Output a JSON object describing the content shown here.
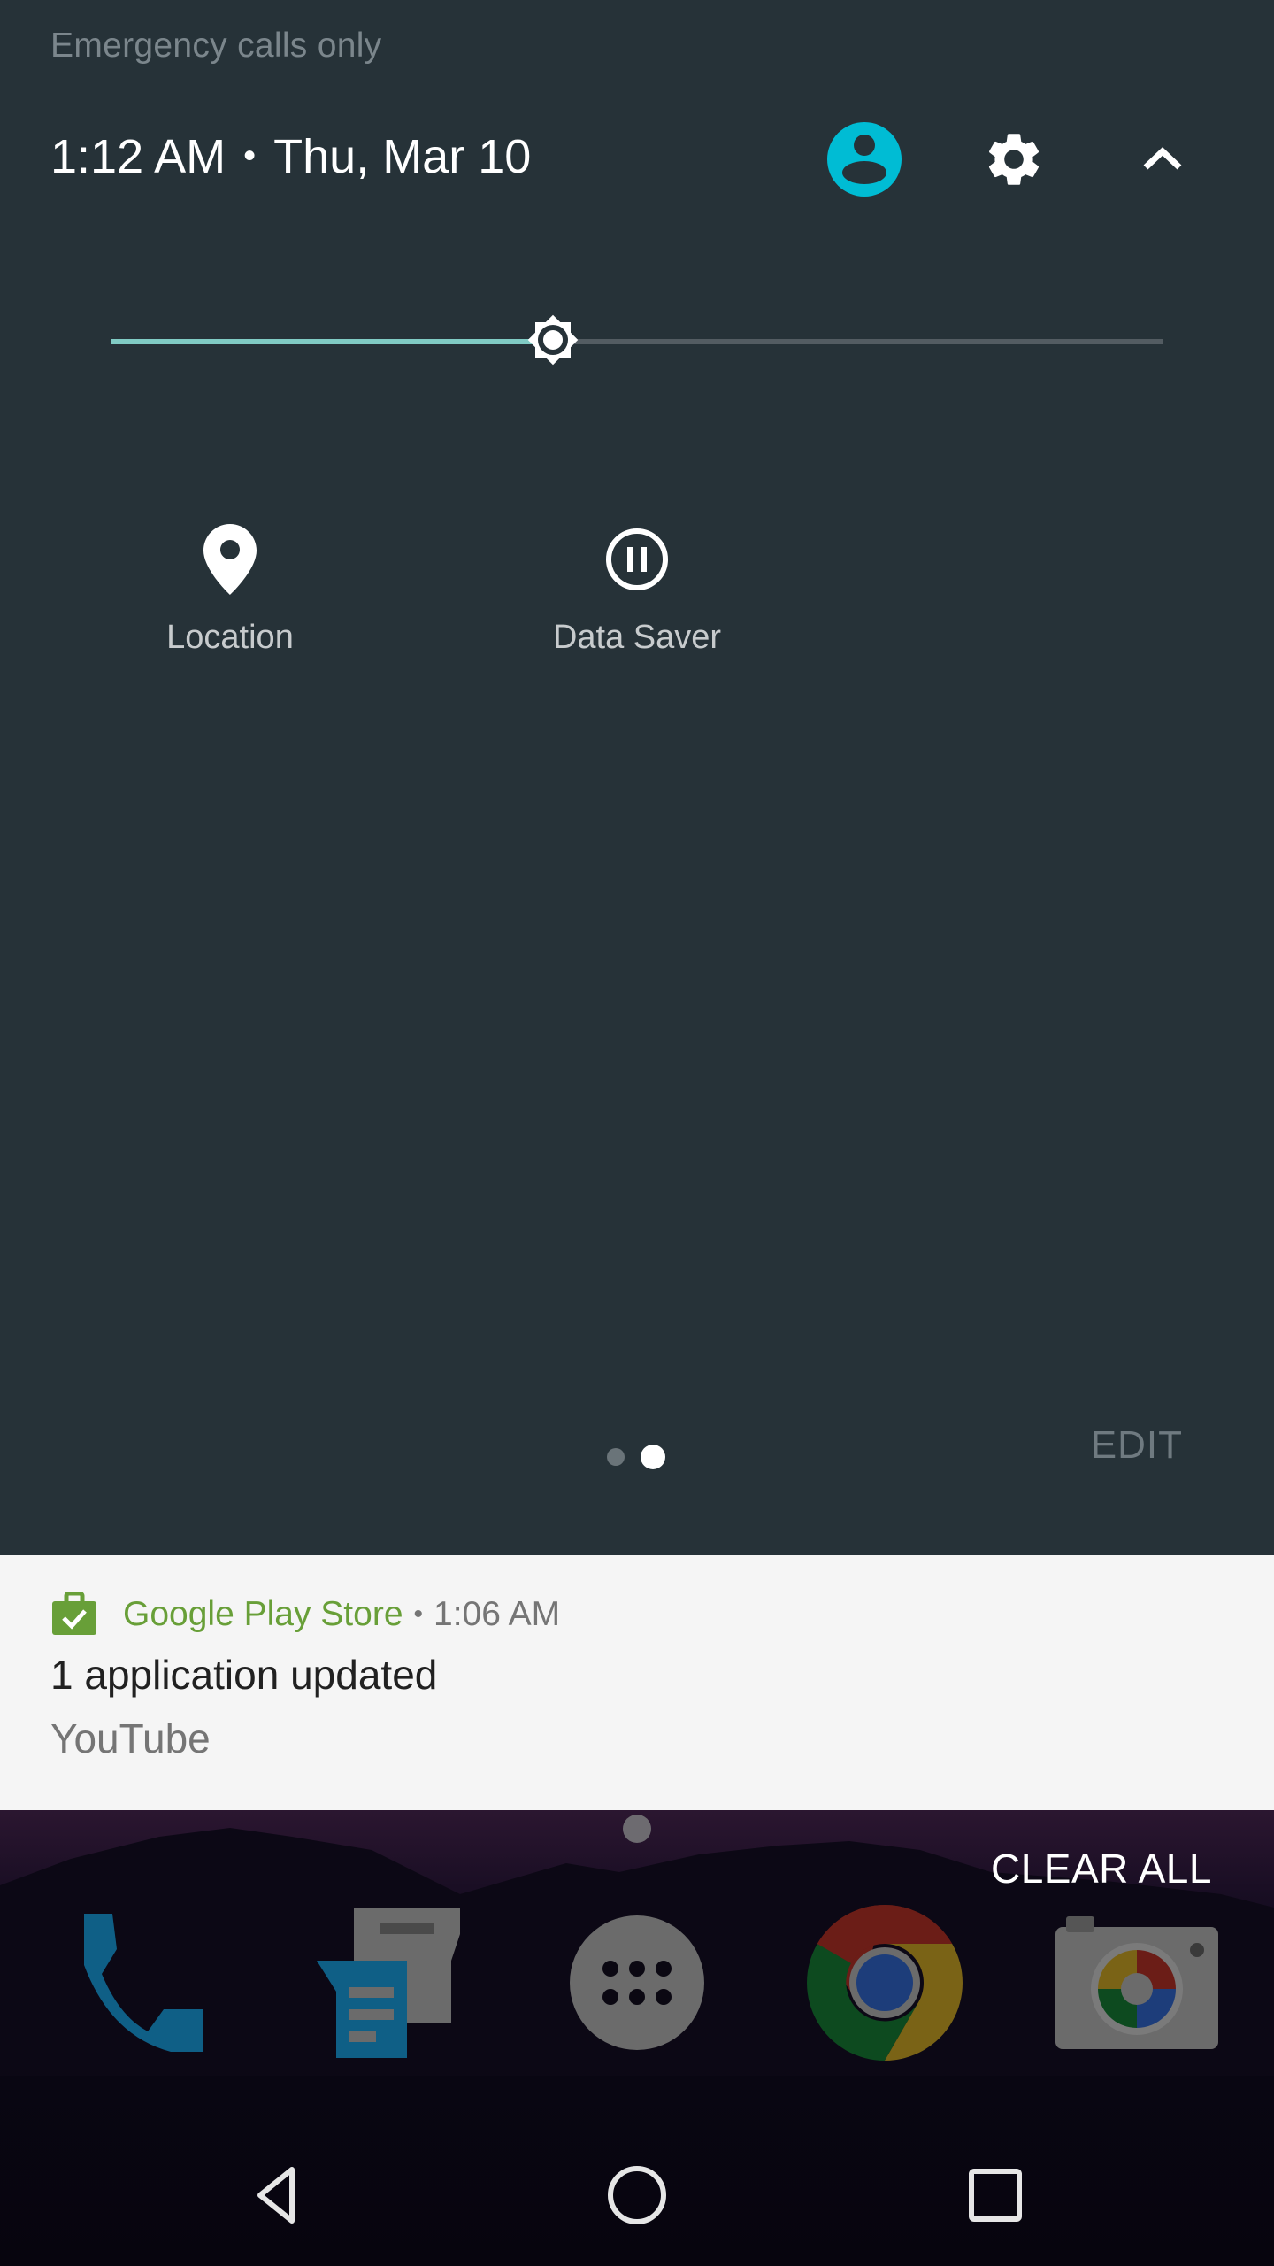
{
  "status": {
    "carrier_text": "Emergency calls only"
  },
  "header": {
    "time": "1:12 AM",
    "separator": "•",
    "date": "Thu, Mar 10",
    "icons": [
      "user-avatar-icon",
      "gear-icon",
      "chevron-up-icon"
    ],
    "avatar_color": "#00bcd4"
  },
  "brightness": {
    "value_fraction": 0.42,
    "fill_color": "#80cbc4",
    "icon": "brightness-icon"
  },
  "tiles": [
    {
      "label": "Location",
      "icon": "location-pin-icon"
    },
    {
      "label": "Data Saver",
      "icon": "data-saver-icon"
    }
  ],
  "pager": {
    "pages": 2,
    "current_page": 2
  },
  "edit_label": "EDIT",
  "notification": {
    "app_name": "Google Play Store",
    "separator": "•",
    "time": "1:06 AM",
    "title": "1 application updated",
    "text": "YouTube",
    "icon": "play-store-updated-icon",
    "app_color": "#689f38"
  },
  "clear_all_label": "CLEAR ALL",
  "dock": [
    {
      "name": "Phone",
      "icon": "phone-icon"
    },
    {
      "name": "Messenger",
      "icon": "messages-icon"
    },
    {
      "name": "Apps",
      "icon": "app-drawer-icon"
    },
    {
      "name": "Chrome",
      "icon": "chrome-icon"
    },
    {
      "name": "Camera",
      "icon": "camera-icon"
    }
  ],
  "navbar": [
    "back-icon",
    "home-icon",
    "recents-icon"
  ]
}
